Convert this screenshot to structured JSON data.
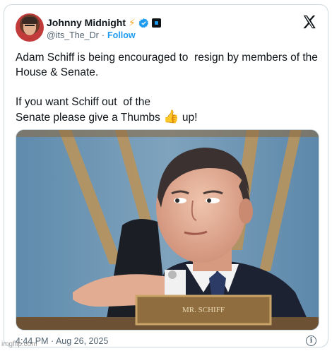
{
  "author": {
    "display_name": "Johnny Midnight",
    "handle": "@its_The_Dr",
    "separator": "·",
    "follow_label": "Follow",
    "bolt_glyph": "⚡",
    "icons": [
      "bolt-icon",
      "verified-icon",
      "affiliate-badge-icon"
    ]
  },
  "post": {
    "line1": "Adam Schiff is being encouraged to  resign by members of the House & Senate.",
    "line2": "If you want Schiff out  of the\nSenate please give a Thumbs ",
    "thumb_glyph": "👍",
    "line2_tail": " up!"
  },
  "media": {
    "nameplate_text": "MR. SCHIFF"
  },
  "meta": {
    "timestamp": "4:44 PM · Aug 26, 2025"
  },
  "watermark": "imgflip.com",
  "colors": {
    "accent": "#1d9bf0",
    "secondary_text": "#536471",
    "border": "#cfd9de"
  }
}
